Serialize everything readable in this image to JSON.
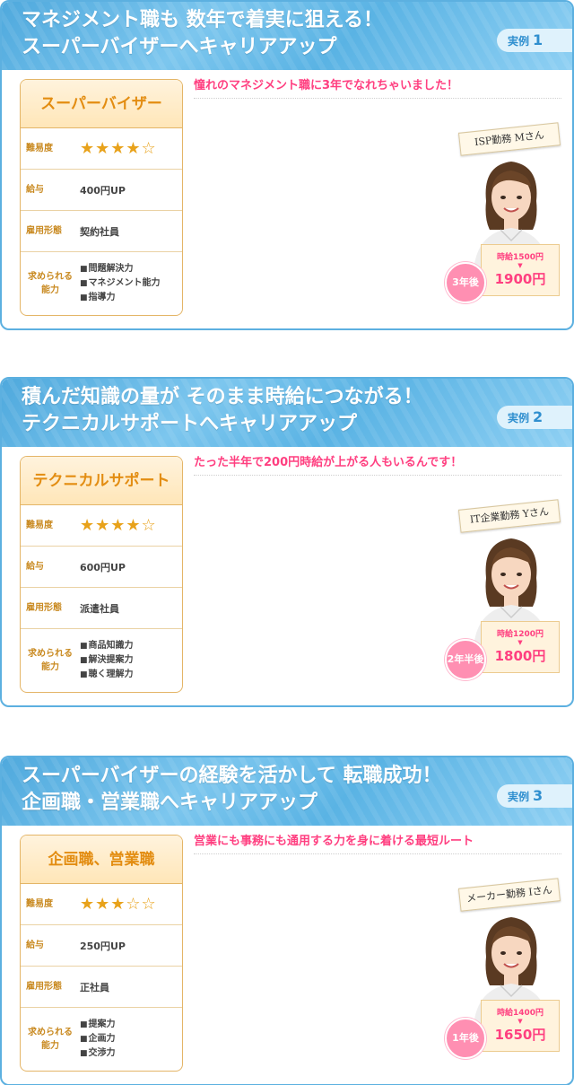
{
  "cases": [
    {
      "title_line1": "マネジメント職も 数年で着実に狙える！",
      "title_line2": "スーパーバイザーへキャリアアップ",
      "case_label": "実例",
      "case_number": "1",
      "role": "スーパーバイザー",
      "difficulty_label": "難易度",
      "difficulty_stars": "★★★★☆",
      "difficulty_rating": 4,
      "pay_label": "給与",
      "pay_value": "400円UP",
      "employment_label": "雇用形態",
      "employment_value": "契約社員",
      "skills_label_1": "求められる",
      "skills_label_2": "能力",
      "skills": [
        "問題解決力",
        "マネジメント能力",
        "指導力"
      ],
      "catchphrase": "憧れのマネジメント職に3年でなれちゃいました！",
      "person_tag": "ISP勤務 Mさん",
      "period": "3年後",
      "wage_before": "時給1500円",
      "wage_after": "1900円"
    },
    {
      "title_line1": "積んだ知識の量が そのまま時給につながる！",
      "title_line2": "テクニカルサポートへキャリアアップ",
      "case_label": "実例",
      "case_number": "2",
      "role": "テクニカルサポート",
      "difficulty_label": "難易度",
      "difficulty_stars": "★★★★☆",
      "difficulty_rating": 4,
      "pay_label": "給与",
      "pay_value": "600円UP",
      "employment_label": "雇用形態",
      "employment_value": "派遣社員",
      "skills_label_1": "求められる",
      "skills_label_2": "能力",
      "skills": [
        "商品知識力",
        "解決提案力",
        "聴く理解力"
      ],
      "catchphrase": "たった半年で200円時給が上がる人もいるんです！",
      "person_tag": "IT企業勤務 Yさん",
      "period": "2年半後",
      "wage_before": "時給1200円",
      "wage_after": "1800円"
    },
    {
      "title_line1": "スーパーバイザーの経験を活かして 転職成功！",
      "title_line2": "企画職・営業職へキャリアアップ",
      "case_label": "実例",
      "case_number": "3",
      "role": "企画職、営業職",
      "difficulty_label": "難易度",
      "difficulty_stars": "★★★☆☆",
      "difficulty_rating": 3,
      "pay_label": "給与",
      "pay_value": "250円UP",
      "employment_label": "雇用形態",
      "employment_value": "正社員",
      "skills_label_1": "求められる",
      "skills_label_2": "能力",
      "skills": [
        "提案力",
        "企画力",
        "交渉力"
      ],
      "catchphrase": "営業にも事務にも通用する力を身に着ける最短ルート",
      "person_tag": "メーカー勤務 Iさん",
      "period": "1年後",
      "wage_before": "時給1400円",
      "wage_after": "1650円"
    }
  ],
  "colors": {
    "header_blue": "#4fa9dd",
    "accent_orange": "#e38d12",
    "accent_pink": "#ff3f80",
    "star_gold": "#e8a21b"
  },
  "icons": {
    "star": "star-icon",
    "arrow": "down-arrow-icon"
  }
}
